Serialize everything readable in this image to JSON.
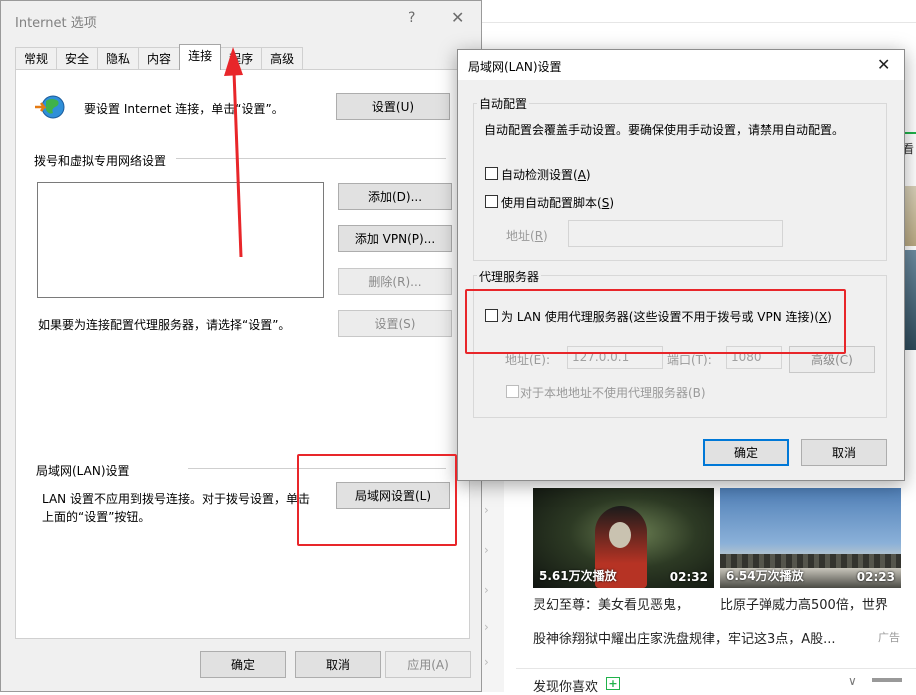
{
  "background": {
    "side_text": "大看",
    "videos": [
      {
        "views": "5.61万次播放",
        "duration": "02:32",
        "title": "灵幻至尊：美女看见恶鬼，"
      },
      {
        "views": "6.54万次播放",
        "duration": "02:23",
        "title": "比原子弹威力高500倍，世界"
      }
    ],
    "news_line": "股神徐翔狱中耀出庄家洗盘规律，牢记这3点，A股...",
    "ad_label": "广告",
    "discover_label": "发现你喜欢"
  },
  "internet_options": {
    "title": "Internet 选项",
    "help_glyph": "?",
    "close_glyph": "✕",
    "tabs": [
      "常规",
      "安全",
      "隐私",
      "内容",
      "连接",
      "程序",
      "高级"
    ],
    "active_tab": "连接",
    "setup_text": "要设置 Internet 连接，单击“设置”。",
    "setup_button": "设置(U)",
    "dialup_section": "拨号和虚拟专用网络设置",
    "add_button": "添加(D)...",
    "add_vpn_button": "添加 VPN(P)...",
    "remove_button": "删除(R)...",
    "proxy_hint": "如果要为连接配置代理服务器，请选择“设置”。",
    "settings_button": "设置(S)",
    "lan_section": "局域网(LAN)设置",
    "lan_text_1": "LAN 设置不应用到拨号连接。对于拨号设置，单击",
    "lan_text_2": "上面的“设置”按钮。",
    "lan_button": "局域网设置(L)",
    "ok_button": "确定",
    "cancel_button": "取消",
    "apply_button": "应用(A)"
  },
  "lan_settings": {
    "title": "局域网(LAN)设置",
    "close_glyph": "✕",
    "auto_group": "自动配置",
    "auto_desc": "自动配置会覆盖手动设置。要确保使用手动设置，请禁用自动配置。",
    "auto_detect_pre": "自动检测设置(",
    "auto_detect_key": "A",
    "auto_detect_post": ")",
    "auto_detect_checked": false,
    "auto_script_pre": "使用自动配置脚本(",
    "auto_script_key": "S",
    "auto_script_post": ")",
    "auto_script_checked": false,
    "address_pre": "地址(",
    "address_key": "R",
    "address_post": ")",
    "proxy_group": "代理服务器",
    "use_proxy_pre": "为 LAN 使用代理服务器(这些设置不用于拨号或 VPN 连接)(",
    "use_proxy_key": "X",
    "use_proxy_post": ")",
    "use_proxy_checked": false,
    "proxy_address_label": "地址(E):",
    "proxy_address_value": "127.0.0.1",
    "port_label": "端口(T):",
    "port_value": "1080",
    "advanced_button": "高级(C)",
    "bypass_label": "对于本地地址不使用代理服务器(B)",
    "ok_button": "确定",
    "cancel_button": "取消"
  },
  "colors": {
    "annotation_red": "#e8262a",
    "focus_blue": "#0078d7",
    "dialog_gray": "#f0f0f0"
  },
  "icons": {
    "globe": "globe-network-icon"
  }
}
